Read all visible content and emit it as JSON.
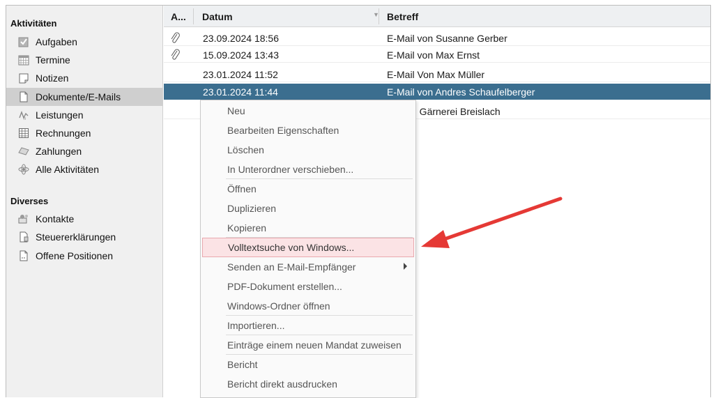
{
  "sidebar": {
    "sections": [
      {
        "title": "Aktivitäten",
        "items": [
          {
            "label": "Aufgaben",
            "icon": "task-check-icon"
          },
          {
            "label": "Termine",
            "icon": "calendar-icon"
          },
          {
            "label": "Notizen",
            "icon": "note-icon"
          },
          {
            "label": "Dokumente/E-Mails",
            "icon": "document-icon",
            "active": true
          },
          {
            "label": "Leistungen",
            "icon": "service-icon"
          },
          {
            "label": "Rechnungen",
            "icon": "invoice-icon"
          },
          {
            "label": "Zahlungen",
            "icon": "payment-icon"
          },
          {
            "label": "Alle Aktivitäten",
            "icon": "all-activities-icon"
          }
        ]
      },
      {
        "title": "Diverses",
        "items": [
          {
            "label": "Kontakte",
            "icon": "contacts-icon"
          },
          {
            "label": "Steuererklärungen",
            "icon": "tax-return-icon"
          },
          {
            "label": "Offene Positionen",
            "icon": "open-items-icon"
          }
        ]
      }
    ]
  },
  "table": {
    "columns": [
      "A...",
      "Datum",
      "Betreff"
    ],
    "rows": [
      {
        "attachment": true,
        "datum": "23.09.2024 18:56",
        "betreff": "E-Mail von Susanne Gerber"
      },
      {
        "attachment": true,
        "datum": "15.09.2024 13:43",
        "betreff": "E-Mail von Max Ernst"
      },
      {
        "attachment": false,
        "datum": "23.01.2024 11:52",
        "betreff": "E-Mail Von Max Müller"
      },
      {
        "attachment": false,
        "datum": "23.01.2024 11:44",
        "betreff": "E-Mail von Andres Schaufelberger",
        "selected": true
      },
      {
        "attachment": false,
        "datum": "",
        "betreff": "n Gärnerei Breislach"
      }
    ]
  },
  "context_menu": {
    "items": [
      {
        "label": "Neu"
      },
      {
        "label": "Bearbeiten Eigenschaften"
      },
      {
        "label": "Löschen"
      },
      {
        "label": "In Unterordner verschieben..."
      },
      {
        "label": "Öffnen"
      },
      {
        "label": "Duplizieren"
      },
      {
        "label": "Kopieren"
      },
      {
        "label": "Volltextsuche von Windows...",
        "highlighted": true
      },
      {
        "label": "Senden an E-Mail-Empfänger",
        "submenu": true
      },
      {
        "label": "PDF-Dokument erstellen..."
      },
      {
        "label": "Windows-Ordner öffnen"
      },
      {
        "label": "Importieren..."
      },
      {
        "label": "Einträge einem neuen Mandat zuweisen"
      },
      {
        "label": "Bericht"
      },
      {
        "label": "Bericht direkt ausdrucken"
      }
    ]
  },
  "colors": {
    "selection": "#3b6e8f",
    "highlight_bg": "#fbe3e5",
    "highlight_border": "#e9a8ae",
    "arrow": "#e53935"
  }
}
